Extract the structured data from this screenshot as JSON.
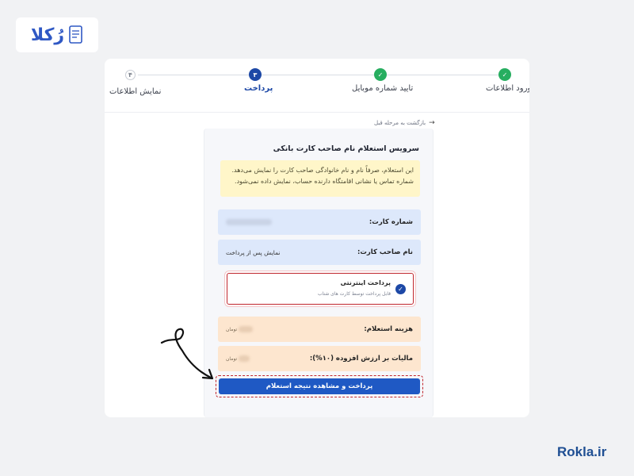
{
  "brand": {
    "name": "رُکلا",
    "url": "Rokla.ir"
  },
  "stepper": {
    "steps": [
      {
        "label": "ورود اطلاعات",
        "state": "done",
        "marker": "✓"
      },
      {
        "label": "تایید شماره موبایل",
        "state": "done",
        "marker": "✓"
      },
      {
        "label": "پرداخت",
        "state": "active",
        "marker": "۳"
      },
      {
        "label": "نمایش اطلاعات",
        "state": "pending",
        "marker": "۴"
      }
    ]
  },
  "back_link": "بازگشت به مرحله قبل",
  "service": {
    "title": "سرویس استعلام نام صاحب کارت بانکی",
    "notice_line1": "این استعلام، صرفاً نام و نام خانوادگی صاحب کارت را نمایش می‌دهد.",
    "notice_line2": "شماره تماس یا نشانی اقامتگاه دارنده حساب، نمایش داده نمی‌شود."
  },
  "fields": {
    "card_number_label": "شماره کارت:",
    "holder_name_label": "نام صاحب کارت:",
    "holder_name_value": "نمایش پس از پرداخت",
    "fee_label": "هزینه استعلام:",
    "fee_unit": "تومان",
    "vat_label": "مالیات بر ارزش افزوده (۱۰%):",
    "vat_unit": "تومان"
  },
  "payment_option": {
    "title": "پرداخت اینترنتی",
    "subtitle": "قابل پرداخت توسط کارت های شتاب",
    "selected": true
  },
  "submit_label": "پرداخت و مشاهده نتیجه استعلام",
  "colors": {
    "accent": "#1f59c4",
    "success": "#27ae60",
    "highlight": "#c0262d",
    "notice_bg": "#fff6c9"
  }
}
